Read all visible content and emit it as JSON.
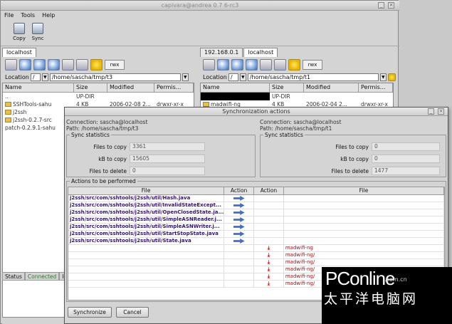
{
  "window": {
    "title": "capivara@andrea 0.7 6-rc3"
  },
  "menu": [
    "File",
    "Tools",
    "Help"
  ],
  "toolbar": {
    "copy_label": "Copy",
    "sync_label": "Sync"
  },
  "left_panel": {
    "tab": "localhost",
    "rwx": "rwx",
    "location_label": "Location",
    "root": "/",
    "path": "/home/sascha/tmp/t3",
    "columns": [
      "Name",
      "Size",
      "Modified",
      "Permis..."
    ],
    "rows": [
      {
        "name": "..",
        "size": "UP-DIR",
        "modified": "",
        "perm": ""
      },
      {
        "name": "SSHTools-sahu",
        "size": "4 KB",
        "modified": "2006-02-08 2...",
        "perm": "drwxr-xr-x",
        "folder": true
      },
      {
        "name": "j2ssh",
        "size": "",
        "modified": "",
        "perm": "",
        "folder": true
      },
      {
        "name": "j2ssh-0.2.7-src",
        "size": "",
        "modified": "",
        "perm": "",
        "folder": true
      },
      {
        "name": "patch-0.2.9.1-sahu",
        "size": "",
        "modified": "",
        "perm": ""
      }
    ]
  },
  "right_panel": {
    "tabs": [
      "192.168.0.1",
      "localhost"
    ],
    "rwx": "rwx",
    "location_label": "Location",
    "root": "/",
    "path": "/home/sascha/tmp/t1",
    "columns": [
      "Name",
      "Size",
      "Modified",
      "Permis..."
    ],
    "rows": [
      {
        "name": "",
        "size": "UP-DIR",
        "modified": "",
        "perm": ""
      },
      {
        "name": "madwifi-ng",
        "size": "4 KB",
        "modified": "2006-02-04 2...",
        "perm": "drwxr-xr-x",
        "folder": true
      }
    ]
  },
  "statusbar": [
    "Status",
    "Connected",
    "lo"
  ],
  "dialog": {
    "title": "Synchronization actions",
    "left": {
      "connection": "Connection: sascha@localhost",
      "path": "Path: /home/sascha/tmp/t3",
      "group": "Sync statistics",
      "files_to_copy_label": "Files to copy",
      "files_to_copy": "3361",
      "kb_to_copy_label": "kB to copy",
      "kb_to_copy": "15605",
      "files_to_delete_label": "Files to delete",
      "files_to_delete": "0"
    },
    "right": {
      "connection": "Connection: sascha@localhost",
      "path": "Path: /home/sascha/tmp/t1",
      "group": "Sync statistics",
      "files_to_copy_label": "Files to copy",
      "files_to_copy": "0",
      "kb_to_copy_label": "kB to copy",
      "kb_to_copy": "0",
      "files_to_delete_label": "Files to delete",
      "files_to_delete": "1477"
    },
    "actions_group": "Actions to be performed",
    "columns": [
      "File",
      "Action",
      "Action",
      "File"
    ],
    "copy_rows": [
      "j2ssh/src/com/sshtools/j2ssh/util/Hash.java",
      "j2ssh/src/com/sshtools/j2ssh/util/InvalidStateExcept...",
      "j2ssh/src/com/sshtools/j2ssh/util/OpenClosedState.ja...",
      "j2ssh/src/com/sshtools/j2ssh/util/SimpleASNReader.j...",
      "j2ssh/src/com/sshtools/j2ssh/util/SimpleASNWriter.j...",
      "j2ssh/src/com/sshtools/j2ssh/util/StartStopState.java",
      "j2ssh/src/com/sshtools/j2ssh/util/State.java"
    ],
    "delete_rows": [
      "madwifi-ng",
      "madwifi-ng/",
      "madwifi-ng/",
      "madwifi-ng/",
      "madwifi-ng/",
      "madwifi-ng/"
    ],
    "synchronize_label": "Synchronize",
    "cancel_label": "Cancel"
  },
  "watermark": {
    "brand": "PConline",
    "domain": ".com.cn",
    "sub": "太平洋电脑网"
  }
}
